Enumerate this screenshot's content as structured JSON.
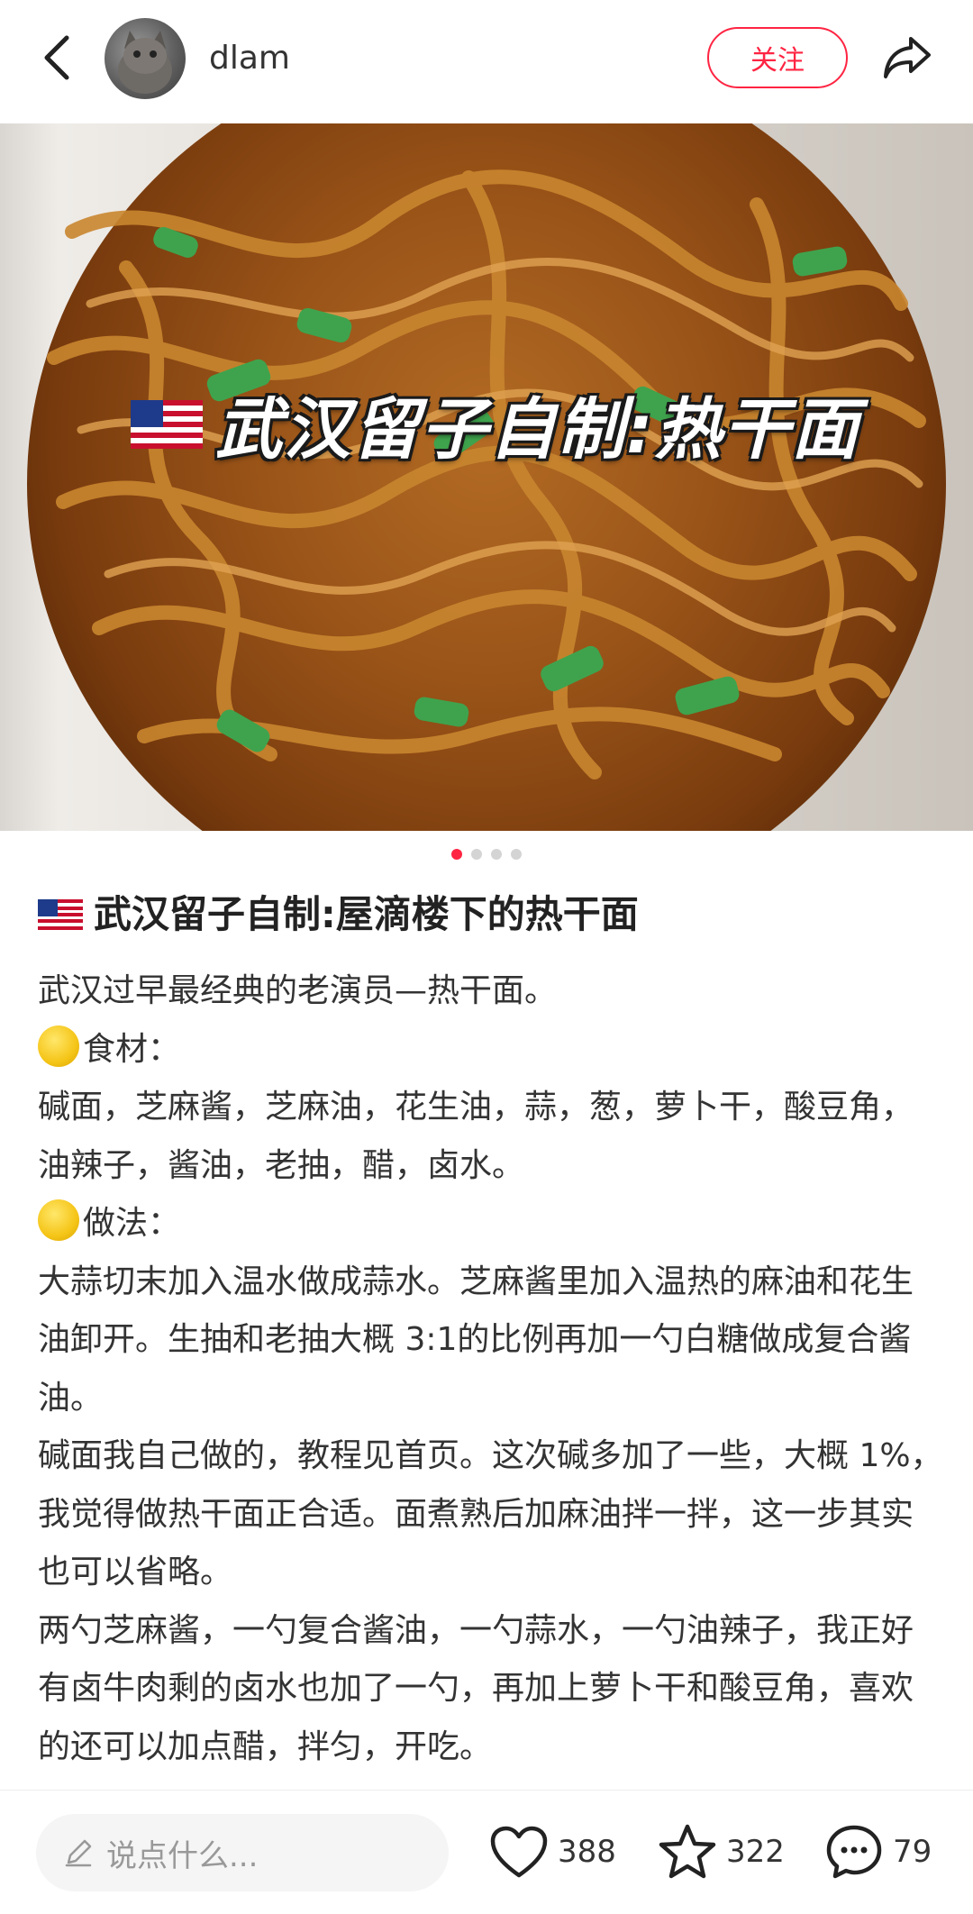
{
  "header": {
    "username": "dlam",
    "follow_label": "关注"
  },
  "hero": {
    "overlay_title": "武汉留子自制:热干面",
    "carousel_count": 4,
    "carousel_active": 1
  },
  "post": {
    "title": "武汉留子自制:屋滴楼下的热干面",
    "paragraphs": [
      "武汉过早最经典的老演员—热干面。",
      "食材：",
      "碱面，芝麻酱，芝麻油，花生油，蒜，葱，萝卜干，酸豆角，油辣子，酱油，老抽，醋，卤水。",
      "做法：",
      "大蒜切末加入温水做成蒜水。芝麻酱里加入温热的麻油和花生油卸开。生抽和老抽大概 3:1的比例再加一勺白糖做成复合酱油。",
      "碱面我自己做的，教程见首页。这次碱多加了一些，大概 1%，我觉得做热干面正合适。面煮熟后加麻油拌一拌，这一步其实也可以省略。",
      "两勺芝麻酱，一勺复合酱油，一勺蒜水，一勺油辣子，我正好有卤牛肉剩的卤水也加了一勺，再加上萝卜干和酸豆角，喜欢的还可以加点醋，拌匀，开吃。"
    ]
  },
  "bottom": {
    "comment_placeholder": "说点什么...",
    "likes": "388",
    "favorites": "322",
    "comments": "79"
  },
  "colors": {
    "accent": "#ff2442"
  }
}
